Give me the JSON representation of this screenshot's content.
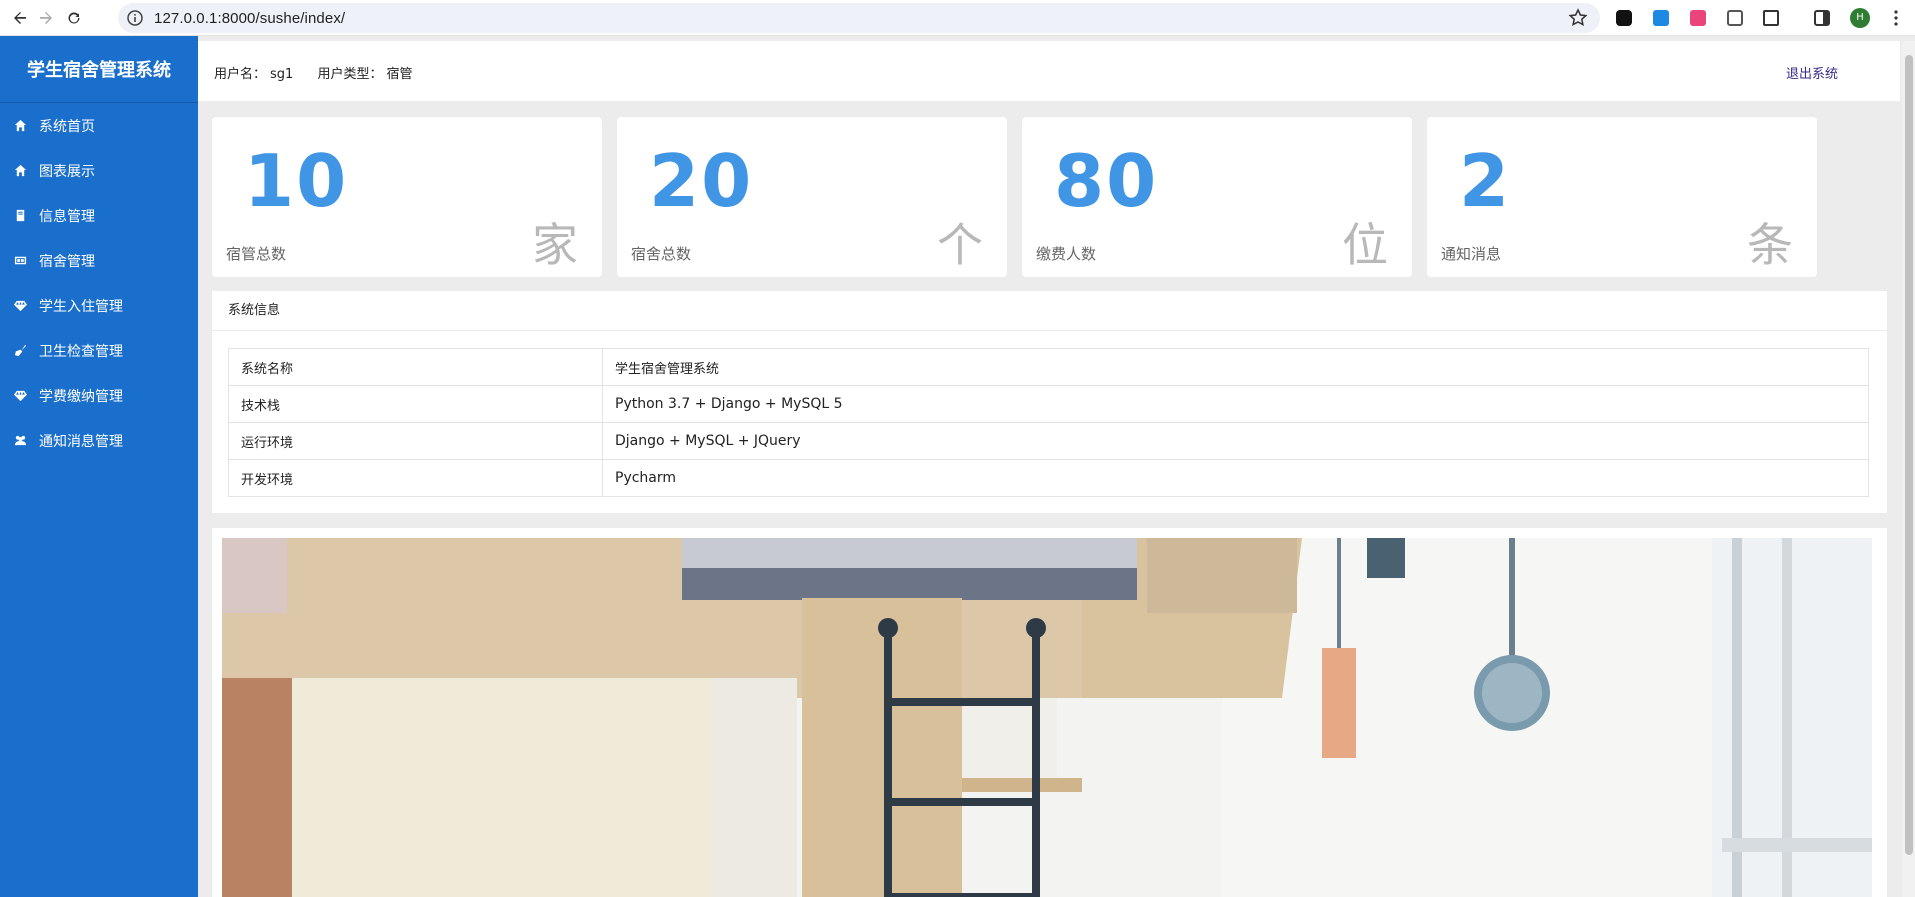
{
  "browser": {
    "url": "127.0.0.1:8000/sushe/index/",
    "profile_initial": "H"
  },
  "sidebar": {
    "brand": "学生宿舍管理系统",
    "items": [
      {
        "label": "系统首页",
        "icon": "home-icon"
      },
      {
        "label": "图表展示",
        "icon": "home-icon"
      },
      {
        "label": "信息管理",
        "icon": "book-icon"
      },
      {
        "label": "宿舍管理",
        "icon": "grid-icon"
      },
      {
        "label": "学生入住管理",
        "icon": "diamond-icon"
      },
      {
        "label": "卫生检查管理",
        "icon": "broom-icon"
      },
      {
        "label": "学费缴纳管理",
        "icon": "diamond-icon"
      },
      {
        "label": "通知消息管理",
        "icon": "users-icon"
      }
    ]
  },
  "header": {
    "username_label": "用户名：",
    "username": "sg1",
    "usertype_label": "用户类型：",
    "usertype": "宿管",
    "logout": "退出系统"
  },
  "stats": [
    {
      "value": "10",
      "label": "宿管总数",
      "unit": "家"
    },
    {
      "value": "20",
      "label": "宿舍总数",
      "unit": "个"
    },
    {
      "value": "80",
      "label": "缴费人数",
      "unit": "位"
    },
    {
      "value": "2",
      "label": "通知消息",
      "unit": "条"
    }
  ],
  "system_info": {
    "title": "系统信息",
    "rows": [
      {
        "key": "系统名称",
        "value": "学生宿舍管理系统"
      },
      {
        "key": "技术栈",
        "value": "Python 3.7 + Django + MySQL 5"
      },
      {
        "key": "运行环境",
        "value": "Django + MySQL + JQuery"
      },
      {
        "key": "开发环境",
        "value": "Pycharm"
      }
    ]
  },
  "colors": {
    "sidebar": "#1b6fcc",
    "accent_number": "#4095e5",
    "logout": "#3a2a8c"
  }
}
